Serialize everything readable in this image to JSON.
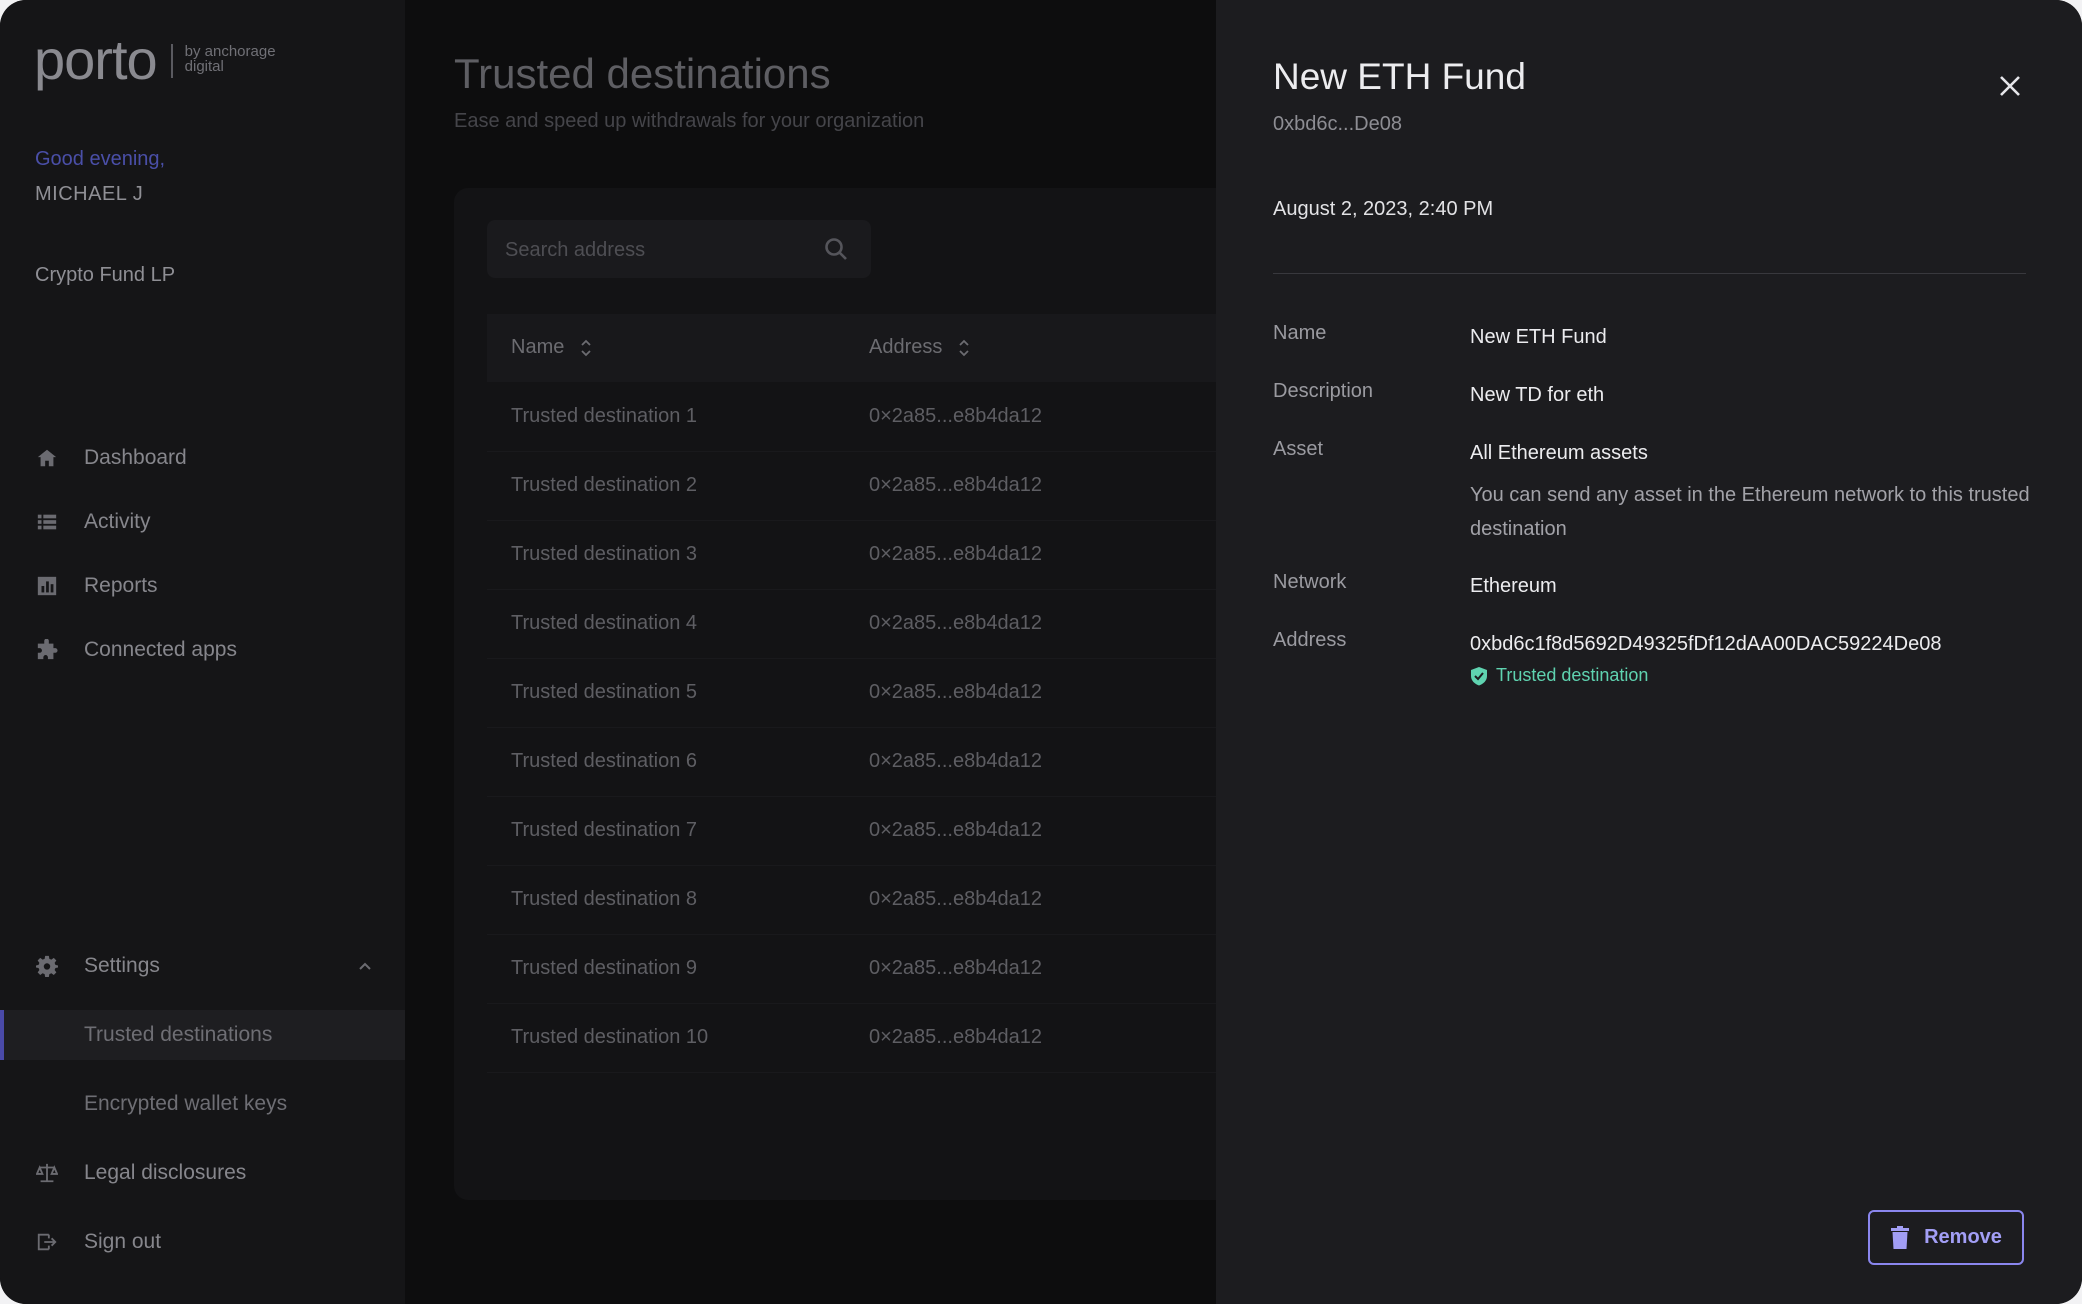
{
  "brand": {
    "name": "porto",
    "tagline_line1": "by anchorage",
    "tagline_line2": "digital"
  },
  "sidebar": {
    "greeting": "Good evening,",
    "user_name": "MICHAEL J",
    "organization": "Crypto Fund LP",
    "nav": [
      {
        "label": "Dashboard",
        "icon": "home-icon"
      },
      {
        "label": "Activity",
        "icon": "list-icon"
      },
      {
        "label": "Reports",
        "icon": "bar-chart-icon"
      },
      {
        "label": "Connected apps",
        "icon": "puzzle-icon"
      }
    ],
    "settings": {
      "label": "Settings",
      "icon": "gear-icon",
      "expanded": true,
      "sub_items": [
        {
          "label": "Trusted destinations",
          "active": true
        },
        {
          "label": "Encrypted wallet keys",
          "active": false
        }
      ]
    },
    "bottom": [
      {
        "label": "Legal disclosures",
        "icon": "scale-icon"
      },
      {
        "label": "Sign out",
        "icon": "sign-out-icon"
      }
    ],
    "accent_color": "#4a4aa8"
  },
  "main": {
    "title": "Trusted destinations",
    "subtitle": "Ease and speed up withdrawals for your organization",
    "search": {
      "placeholder": "Search address"
    },
    "table": {
      "columns": [
        "Name",
        "Address"
      ],
      "rows": [
        {
          "name": "Trusted destination 1",
          "address": "0×2a85...e8b4da12"
        },
        {
          "name": "Trusted destination 2",
          "address": "0×2a85...e8b4da12"
        },
        {
          "name": "Trusted destination 3",
          "address": "0×2a85...e8b4da12"
        },
        {
          "name": "Trusted destination 4",
          "address": "0×2a85...e8b4da12"
        },
        {
          "name": "Trusted destination 5",
          "address": "0×2a85...e8b4da12"
        },
        {
          "name": "Trusted destination 6",
          "address": "0×2a85...e8b4da12"
        },
        {
          "name": "Trusted destination 7",
          "address": "0×2a85...e8b4da12"
        },
        {
          "name": "Trusted destination 8",
          "address": "0×2a85...e8b4da12"
        },
        {
          "name": "Trusted destination 9",
          "address": "0×2a85...e8b4da12"
        },
        {
          "name": "Trusted destination 10",
          "address": "0×2a85...e8b4da12"
        }
      ]
    }
  },
  "drawer": {
    "title": "New ETH Fund",
    "short_address": "0xbd6c...De08",
    "date": "August 2, 2023, 2:40 PM",
    "fields": {
      "name": {
        "label": "Name",
        "value": "New ETH Fund"
      },
      "description": {
        "label": "Description",
        "value": "New TD for eth"
      },
      "asset": {
        "label": "Asset",
        "value": "All Ethereum assets",
        "note": "You can send any asset in the Ethereum network to this trusted destination"
      },
      "network": {
        "label": "Network",
        "value": "Ethereum"
      },
      "address": {
        "label": "Address",
        "value": "0xbd6c1f8d5692D49325fDf12dAA00DAC59224De08",
        "badge": "Trusted destination"
      }
    },
    "remove_label": "Remove",
    "colors": {
      "badge": "#5fd3b0",
      "remove": "#a29ef5"
    }
  }
}
